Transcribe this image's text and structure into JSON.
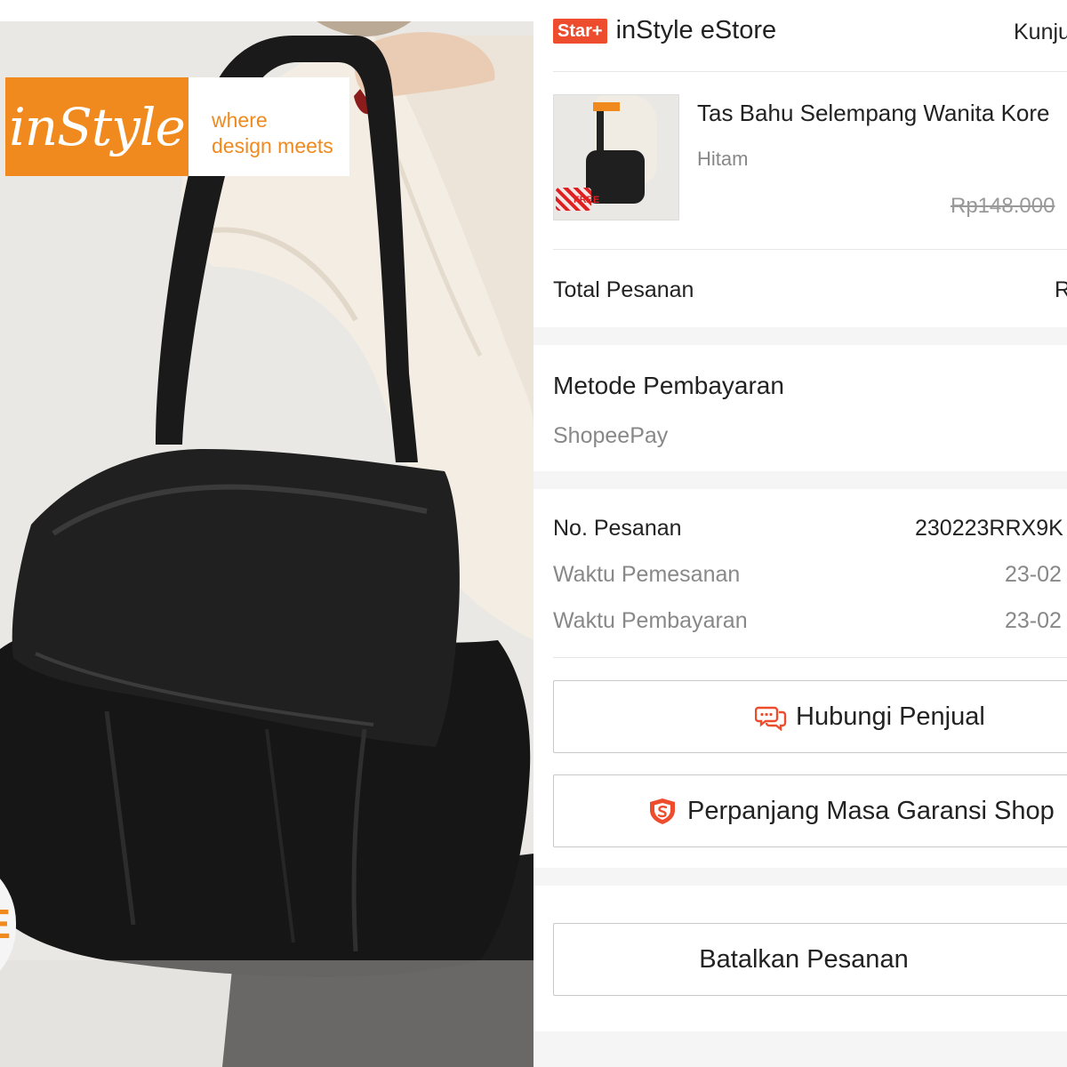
{
  "photo": {
    "brand_logo": "inStyle",
    "brand_tagline_line1": "where",
    "brand_tagline_line2": "design meets",
    "promo_letter": "E",
    "thumb_gift_text": "FREE"
  },
  "shop": {
    "badge": "Star+",
    "name": "inStyle eStore",
    "visit_label": "Kunju"
  },
  "product": {
    "name": "Tas Bahu Selempang Wanita Kore",
    "variant": "Hitam",
    "original_price": "Rp148.000"
  },
  "total": {
    "label": "Total Pesanan",
    "value": "R"
  },
  "payment": {
    "title": "Metode Pembayaran",
    "method": "ShopeePay"
  },
  "order_info": {
    "order_no_label": "No. Pesanan",
    "order_no_value": "230223RRX9K",
    "order_time_label": "Waktu Pemesanan",
    "order_time_value": "23-02",
    "payment_time_label": "Waktu Pembayaran",
    "payment_time_value": "23-02"
  },
  "actions": {
    "contact_seller": "Hubungi Penjual",
    "extend_warranty": "Perpanjang Masa Garansi Shop",
    "cancel_order": "Batalkan Pesanan"
  },
  "colors": {
    "accent": "#ee4d2d",
    "brand_orange": "#f08a1e",
    "background": "#f5f5f5"
  },
  "icons": {
    "contact": "chat-bubbles-icon",
    "warranty": "shield-icon"
  }
}
